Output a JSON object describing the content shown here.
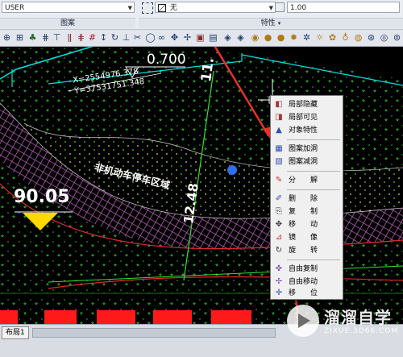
{
  "ribbon": {
    "user_combo": "USER",
    "pattern_panel_title": "图案",
    "fill_combo": "无",
    "properties_panel_title": "特性",
    "scale_value": "1.00"
  },
  "drawing": {
    "label_0700": "0.700",
    "label_11": "11.",
    "coord_x": "X=2554976.378",
    "coord_y": "Y=37531751.348",
    "area_label": "非机动车停车区域",
    "elevation_label": "90.05",
    "dim_label": "12.48"
  },
  "context_menu": {
    "items": [
      {
        "label": "局部隐藏",
        "icon": "hide-icon"
      },
      {
        "label": "局部可见",
        "icon": "show-icon"
      },
      {
        "label": "对象特性",
        "icon": "properties-icon"
      },
      {
        "label": "图案加洞",
        "icon": "hatch-add-hole-icon"
      },
      {
        "label": "图案减洞",
        "icon": "hatch-remove-hole-icon"
      },
      {
        "label": "分　　解",
        "icon": "explode-icon"
      },
      {
        "label": "删　　除",
        "icon": "delete-icon"
      },
      {
        "label": "复　　制",
        "icon": "copy-icon"
      },
      {
        "label": "移　　动",
        "icon": "move-icon"
      },
      {
        "label": "镜　　像",
        "icon": "mirror-icon"
      },
      {
        "label": "旋　　转",
        "icon": "rotate-icon"
      },
      {
        "label": "自由复制",
        "icon": "free-copy-icon"
      },
      {
        "label": "自由移动",
        "icon": "free-move-icon"
      },
      {
        "label": "移　　位",
        "icon": "shift-icon"
      }
    ]
  },
  "status": {
    "layout_tab": "布局1"
  },
  "watermark": {
    "title": "溜溜自学",
    "url": "ZIXUE.3D66.COM"
  },
  "colors": {
    "cad_background": "#000000",
    "cyan_line": "#00e5e5",
    "pink_hatch": "#c86ec8",
    "green_hatch": "#32cd32",
    "yellow_marker": "#ffd800",
    "red_arrow": "#e8322a",
    "red_block": "#ff1a1a"
  }
}
